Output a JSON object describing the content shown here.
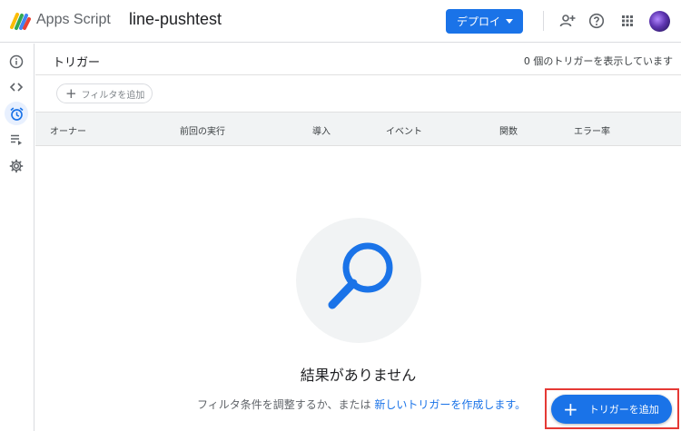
{
  "header": {
    "app_name": "Apps Script",
    "project_name": "line-pushtest",
    "deploy_label": "デプロイ",
    "icons": [
      "add-person-icon",
      "help-icon",
      "apps-grid-icon",
      "account-avatar"
    ]
  },
  "rail": {
    "items": [
      {
        "name": "overview",
        "icon": "info-icon"
      },
      {
        "name": "editor",
        "icon": "code-icon"
      },
      {
        "name": "triggers",
        "icon": "alarm-clock-icon",
        "active": true
      },
      {
        "name": "executions",
        "icon": "executions-list-icon"
      },
      {
        "name": "settings",
        "icon": "gear-icon"
      }
    ]
  },
  "main": {
    "title": "トリガー",
    "count_text": "0 個のトリガーを表示しています",
    "filter_label": "フィルタを追加",
    "columns": [
      "オーナー",
      "前回の実行",
      "導入",
      "イベント",
      "関数",
      "エラー率"
    ],
    "empty_title": "結果がありません",
    "empty_desc_prefix": "フィルタ条件を調整するか、または",
    "empty_desc_link": "新しいトリガーを作成します。",
    "add_trigger_label": "トリガーを追加"
  },
  "colors": {
    "accent": "#1a73e8",
    "highlight_border": "#e53935",
    "table_header_bg": "#f1f3f4"
  }
}
